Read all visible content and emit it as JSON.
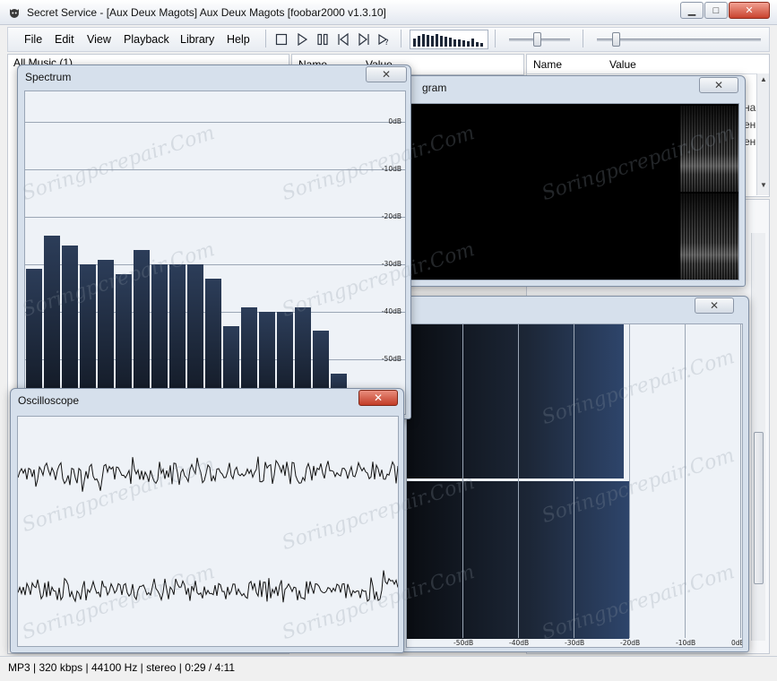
{
  "window": {
    "title": "Secret Service - [Aux Deux Magots] Aux Deux Magots   [foobar2000 v1.3.10]",
    "minimize_label": "▁",
    "maximize_label": "□",
    "close_label": "✕"
  },
  "menu": {
    "items": [
      "File",
      "Edit",
      "View",
      "Playback",
      "Library",
      "Help"
    ]
  },
  "toolbar": {
    "buttons": [
      "stop-icon",
      "play-icon",
      "pause-icon",
      "previous-icon",
      "next-icon",
      "random-icon"
    ]
  },
  "library": {
    "header": "All Music (1)"
  },
  "properties_left": {
    "col_name": "Name",
    "col_value": "Value"
  },
  "properties_right": {
    "col_name": "Name",
    "col_value": "Value",
    "partial_rows": [
      "на",
      "ен",
      "ен"
    ]
  },
  "spectrum": {
    "title": "Spectrum",
    "close_label": "✕",
    "db_labels": [
      "0dB",
      "-10dB",
      "-20dB",
      "-30dB",
      "-40dB",
      "-50dB"
    ],
    "bars_db": [
      -31,
      -24,
      -26,
      -30,
      -29,
      -32,
      -27,
      -30,
      -30,
      -30,
      -33,
      -43,
      -39,
      -40,
      -40,
      -39,
      -44,
      -53
    ]
  },
  "spectrogram": {
    "title_visible": "gram",
    "close_label": "✕"
  },
  "peakmeter": {
    "close_label": "✕",
    "channel_levels_db": [
      -21,
      -20
    ],
    "scale_labels": [
      "-50dB",
      "-40dB",
      "-30dB",
      "-20dB",
      "-10dB",
      "0dB"
    ]
  },
  "oscilloscope": {
    "title": "Oscilloscope",
    "close_label": "✕"
  },
  "status": {
    "text": "MP3 | 320 kbps | 44100 Hz | stereo | 0:29 / 4:11"
  },
  "watermark": {
    "text": "Soringpcrepair.Com"
  }
}
